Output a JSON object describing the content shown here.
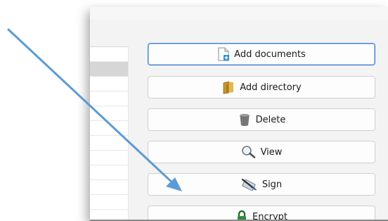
{
  "buttons": {
    "add_documents": "Add documents",
    "add_directory": "Add directory",
    "delete": "Delete",
    "view": "View",
    "sign": "Sign",
    "encrypt": "Encrypt"
  },
  "icons": {
    "add_documents": "document-add-icon",
    "add_directory": "folder-icon",
    "delete": "trash-can-icon",
    "view": "magnifier-icon",
    "sign": "sign-pen-icon",
    "encrypt": "padlock-icon"
  },
  "colors": {
    "focus_border": "#3b7fd6",
    "arrow": "#5b9bd5"
  }
}
